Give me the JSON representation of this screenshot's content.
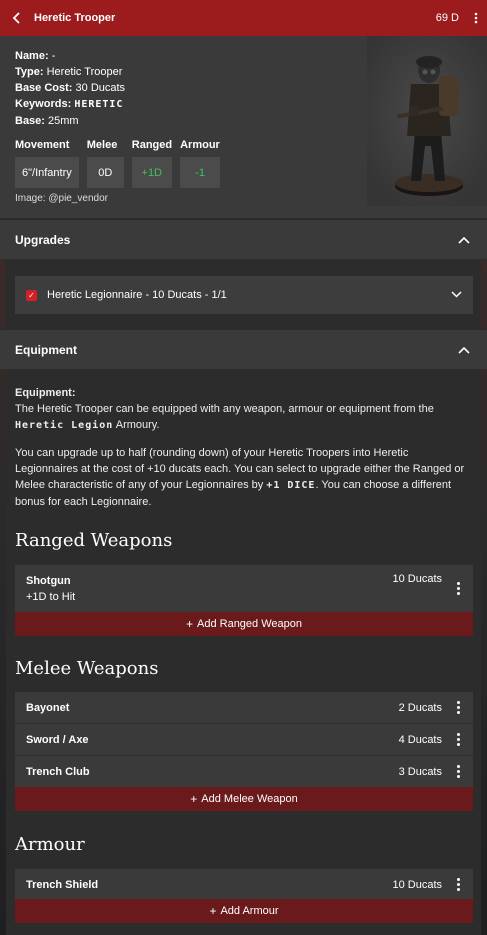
{
  "header": {
    "title": "Heretic Trooper",
    "cost": "69 D",
    "menu_icon": "kebab-menu-icon",
    "back_icon": "chevron-left-icon"
  },
  "unit": {
    "name_label": "Name:",
    "name_value": "-",
    "type_label": "Type:",
    "type_value": "Heretic Trooper",
    "base_cost_label": "Base Cost:",
    "base_cost_value": "30 Ducats",
    "keywords_label": "Keywords:",
    "keywords_value": "HERETIC",
    "base_label": "Base:",
    "base_value": "25mm",
    "stats": [
      {
        "label": "Movement",
        "value": "6\"/Infantry"
      },
      {
        "label": "Melee",
        "value": "0D"
      },
      {
        "label": "Ranged",
        "value": "+1D"
      },
      {
        "label": "Armour",
        "value": "-1"
      }
    ],
    "image_credit": "Image: @pie_vendor"
  },
  "upgrades": {
    "title": "Upgrades",
    "items": [
      {
        "label": "Heretic Legionnaire - 10 Ducats - 1/1",
        "checked": true
      }
    ]
  },
  "equipment": {
    "title": "Equipment",
    "heading": "Equipment:",
    "p1_a": "The Heretic Trooper can be equipped with any weapon, armour or equipment from the",
    "p1_kw": "Heretic Legion",
    "p1_b": "Armoury.",
    "p2_a": "You can upgrade up to half (rounding down) of your Heretic Troopers into Heretic Legionnaires at the cost of +10 ducats each. You can select to upgrade either the Ranged or Melee characteristic of any of your Legionnaires by",
    "p2_kw": "+1 DICE",
    "p2_b": ". You can choose a different bonus for each Legionnaire."
  },
  "ranged": {
    "title": "Ranged Weapons",
    "items": [
      {
        "name": "Shotgun",
        "sub": "+1D to Hit",
        "price": "10 Ducats"
      }
    ],
    "add_label": "Add Ranged Weapon"
  },
  "melee": {
    "title": "Melee Weapons",
    "items": [
      {
        "name": "Bayonet",
        "price": "2 Ducats"
      },
      {
        "name": "Sword / Axe",
        "price": "4 Ducats"
      },
      {
        "name": "Trench Club",
        "price": "3 Ducats"
      }
    ],
    "add_label": "Add Melee Weapon"
  },
  "armour": {
    "title": "Armour",
    "items": [
      {
        "name": "Trench Shield",
        "price": "10 Ducats"
      }
    ],
    "add_label": "Add Armour"
  },
  "colors": {
    "header": "#9c1b1d",
    "add_button": "#6b1a1c",
    "accent_green": "#3ec45a",
    "checkbox": "#d12027"
  }
}
